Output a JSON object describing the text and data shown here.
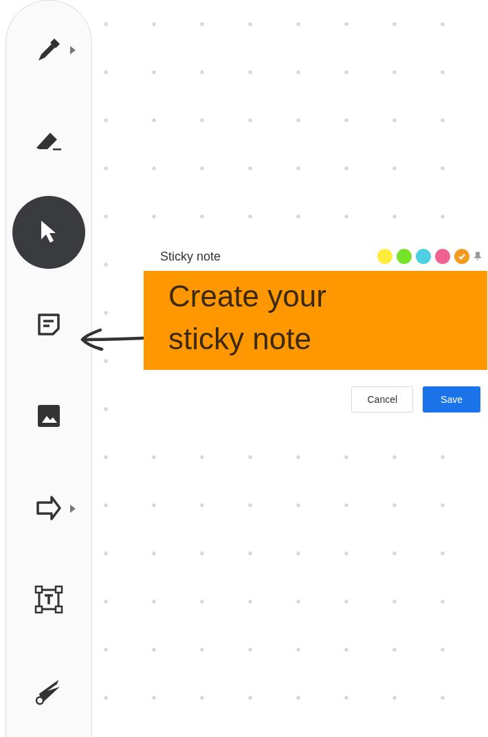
{
  "toolbar": {
    "tools": [
      {
        "kind": "pen",
        "selected": false,
        "has_submenu": true
      },
      {
        "kind": "eraser",
        "selected": false,
        "has_submenu": false
      },
      {
        "kind": "select",
        "selected": true,
        "has_submenu": false
      },
      {
        "kind": "sticky",
        "selected": false,
        "has_submenu": false
      },
      {
        "kind": "image",
        "selected": false,
        "has_submenu": false
      },
      {
        "kind": "shape",
        "selected": false,
        "has_submenu": true
      },
      {
        "kind": "text",
        "selected": false,
        "has_submenu": false
      },
      {
        "kind": "laser",
        "selected": false,
        "has_submenu": false
      }
    ]
  },
  "sticky_dialog": {
    "title": "Sticky note",
    "colors": [
      {
        "color": "#ffeb3b",
        "selected": false
      },
      {
        "color": "#76e22a",
        "selected": false
      },
      {
        "color": "#4dd0e1",
        "selected": false
      },
      {
        "color": "#f06292",
        "selected": false
      },
      {
        "color": "#f39a1e",
        "selected": true
      }
    ],
    "note": {
      "value": "Create your sticky note",
      "color": "#ff9800"
    },
    "buttons": [
      {
        "label": "Cancel",
        "kind": "secondary"
      },
      {
        "label": "Save",
        "kind": "primary"
      }
    ]
  }
}
